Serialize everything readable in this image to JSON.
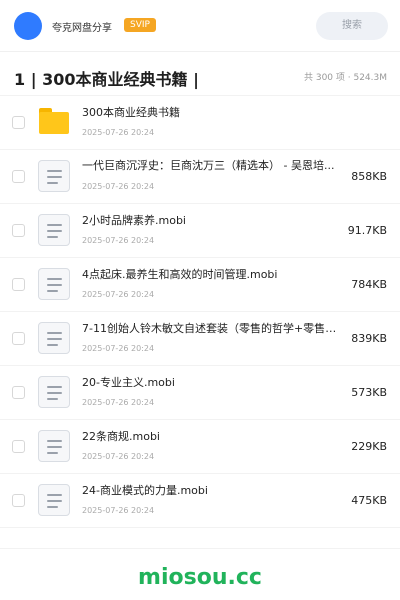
{
  "header": {
    "username": "夸克网盘分享",
    "badge": "SVIP",
    "search_label": "搜索"
  },
  "folder": {
    "title": "1 | 300本商业经典书籍 |",
    "summary": "共 300 项 · 524.3M"
  },
  "items": [
    {
      "name": "300本商业经典书籍",
      "date": "2025-07-26 20:24",
      "size": "",
      "type": "folder"
    },
    {
      "name": "一代巨商沉浮史：巨商沈万三（精选本） - 吴恩培...",
      "date": "2025-07-26 20:24",
      "size": "858KB",
      "type": "file"
    },
    {
      "name": "2小时品牌素养.mobi",
      "date": "2025-07-26 20:24",
      "size": "91.7KB",
      "type": "file"
    },
    {
      "name": "4点起床.最养生和高效的时间管理.mobi",
      "date": "2025-07-26 20:24",
      "size": "784KB",
      "type": "file"
    },
    {
      "name": "7-11创始人铃木敏文自述套装（零售的哲学+零售心...",
      "date": "2025-07-26 20:24",
      "size": "839KB",
      "type": "file"
    },
    {
      "name": "20-专业主义.mobi",
      "date": "2025-07-26 20:24",
      "size": "573KB",
      "type": "file"
    },
    {
      "name": "22条商规.mobi",
      "date": "2025-07-26 20:24",
      "size": "229KB",
      "type": "file"
    },
    {
      "name": "24-商业模式的力量.mobi",
      "date": "2025-07-26 20:24",
      "size": "475KB",
      "type": "file"
    }
  ],
  "footer": {
    "brand": "miosou.cc"
  },
  "colors": {
    "accent": "#2f7bff",
    "badge": "#f5a623",
    "folder": "#ffc61a",
    "brand": "#21b35b"
  }
}
